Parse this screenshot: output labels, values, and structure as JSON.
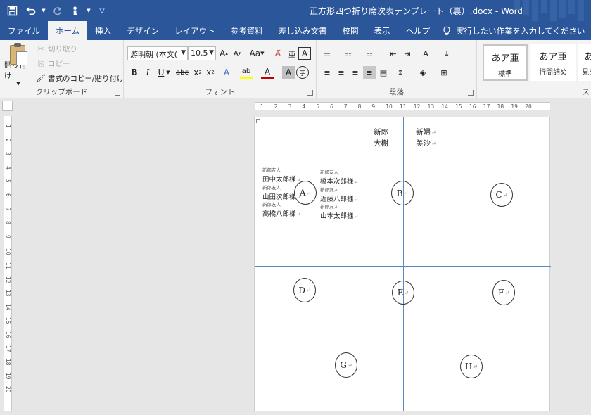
{
  "window": {
    "title": "正方形四つ折り席次表テンプレート（裏）.docx  -  Word"
  },
  "qat": {
    "save_icon": "save-icon",
    "undo_icon": "undo-icon",
    "redo_icon": "redo-icon",
    "touch_icon": "touch-mode-icon",
    "customize_icon": "customize-icon"
  },
  "tabs": [
    "ファイル",
    "ホーム",
    "挿入",
    "デザイン",
    "レイアウト",
    "参考資料",
    "差し込み文書",
    "校閲",
    "表示",
    "ヘルプ"
  ],
  "active_tab": "ホーム",
  "tellme": {
    "placeholder": "実行したい作業を入力してください"
  },
  "clipboard": {
    "paste": "貼り付け",
    "cut": "切り取り",
    "copy": "コピー",
    "format_painter": "書式のコピー/貼り付け",
    "label": "クリップボード"
  },
  "font": {
    "name": "游明朝 (本文(",
    "size": "10.5",
    "case": "Aa",
    "label": "フォント"
  },
  "paragraph": {
    "label": "段落"
  },
  "styles": {
    "items": [
      {
        "sample": "あア亜",
        "name": "標準"
      },
      {
        "sample": "あア亜",
        "name": "行間詰め"
      },
      {
        "sample": "あ",
        "name": "見出"
      }
    ],
    "label": "ス"
  },
  "ruler": {
    "h_ticks": [
      "1",
      "2",
      "3",
      "4",
      "5",
      "6",
      "7",
      "8",
      "9",
      "10",
      "11",
      "12",
      "13",
      "14",
      "15",
      "16",
      "17",
      "18",
      "19",
      "20"
    ],
    "v_ticks": [
      "1",
      "2",
      "3",
      "4",
      "5",
      "6",
      "7",
      "8",
      "9",
      "10",
      "11",
      "12",
      "13",
      "14",
      "15",
      "16",
      "17",
      "18",
      "19",
      "20"
    ]
  },
  "document": {
    "groom_title": "新郎",
    "groom_name": "大樹",
    "bride_title": "新婦",
    "bride_name": "美沙",
    "guests_left": [
      {
        "role": "新郎友人",
        "name": "田中太郎様"
      },
      {
        "role": "新郎友人",
        "name": "山田次郎様"
      },
      {
        "role": "新郎友人",
        "name": "高橋八郎様"
      }
    ],
    "guests_right": [
      {
        "role": "新郎友人",
        "name": "橋本次郎様"
      },
      {
        "role": "新郎友人",
        "name": "近藤八郎様"
      },
      {
        "role": "新郎友人",
        "name": "山本太郎様"
      }
    ],
    "tables": [
      "A",
      "B",
      "C",
      "D",
      "E",
      "F",
      "G",
      "H"
    ],
    "para_mark": "↵"
  }
}
